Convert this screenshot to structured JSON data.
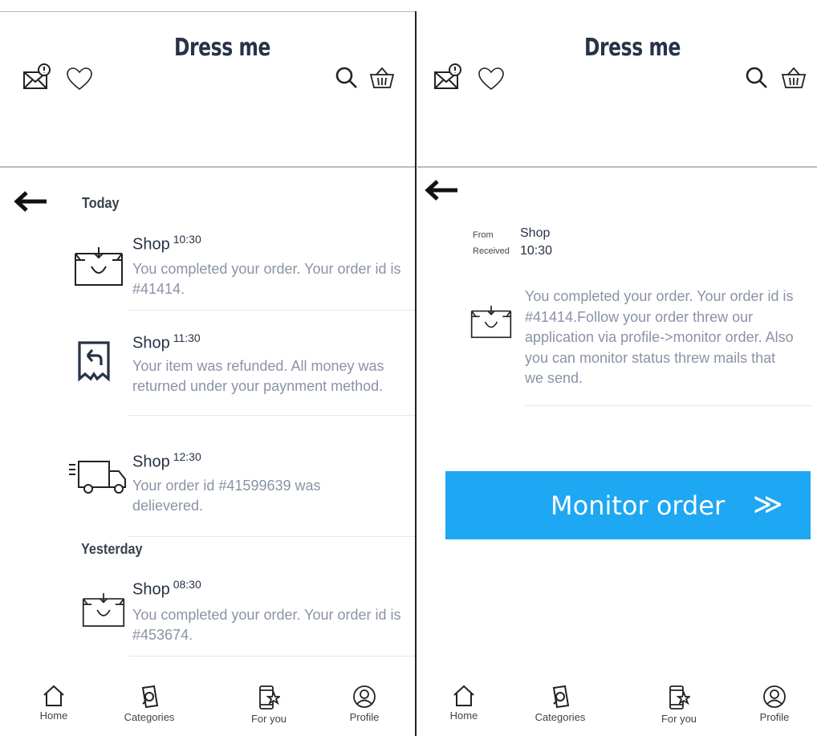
{
  "app": {
    "brand": "Dress me"
  },
  "left_screen": {
    "sections": [
      {
        "label": "Today"
      },
      {
        "label": "Yesterday"
      }
    ],
    "messages": [
      {
        "sender": "Shop",
        "time": "10:30",
        "text": "You completed your order. Your order id is #41414.",
        "icon": "shopping-bag-icon"
      },
      {
        "sender": "Shop",
        "time": "11:30",
        "text": "Your item was refunded. All money was returned under your paynment method.",
        "icon": "refund-receipt-icon"
      },
      {
        "sender": "Shop",
        "time": "12:30",
        "text": "Your order id #41599639 was delievered.",
        "icon": "delivery-truck-icon"
      },
      {
        "sender": "Shop",
        "time": "08:30",
        "text": "You completed your order. Your order id is #453674.",
        "icon": "shopping-bag-icon"
      }
    ]
  },
  "right_screen": {
    "from_label": "From",
    "from_value": "Shop",
    "received_label": "Received",
    "received_value": "10:30",
    "message_text": "You completed your order. Your order id is #41414.Follow your order threw our application via profile->monitor order. Also you can monitor status threw mails that we send.",
    "button_label": "Monitor order",
    "button_arrows": "≫",
    "button_color": "#1ea7f2"
  },
  "nav": {
    "items": [
      {
        "label": "Home",
        "icon": "home-icon"
      },
      {
        "label": "Categories",
        "icon": "categories-icon"
      },
      {
        "label": "For you",
        "icon": "for-you-icon"
      },
      {
        "label": "Profile",
        "icon": "profile-icon"
      }
    ]
  }
}
